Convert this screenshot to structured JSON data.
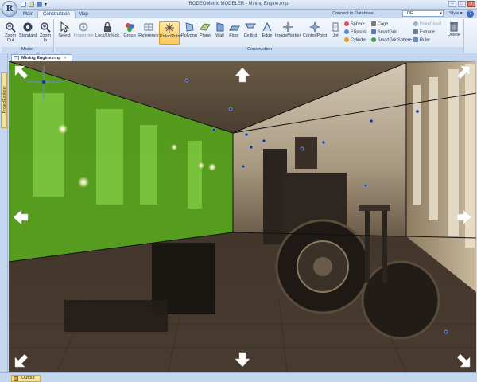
{
  "app": {
    "title": "RODEOMetric MODELER - Mining Engine.rmp",
    "orb_letter": "R"
  },
  "tabs": [
    {
      "label": "Main"
    },
    {
      "label": "Construction"
    },
    {
      "label": "Map"
    }
  ],
  "toolbar_right": {
    "connect_label": "Connect to Database...",
    "ldr_value": "LDR",
    "style_label": "Style",
    "help_glyph": "?"
  },
  "ribbon": {
    "model_group": {
      "label": "Model",
      "buttons": [
        {
          "label": "Zoom\nOut",
          "icon": "zoom-out-icon"
        },
        {
          "label": "Standard",
          "icon": "eye-icon"
        },
        {
          "label": "Zoom\nIn",
          "icon": "zoom-in-icon"
        }
      ]
    },
    "construction_group": {
      "label": "Construction",
      "buttons": [
        {
          "label": "Select",
          "icon": "cursor-icon"
        },
        {
          "label": "Properties",
          "icon": "properties-icon"
        },
        {
          "label": "Lock/Unlock",
          "icon": "lock-icon"
        },
        {
          "label": "Group",
          "icon": "group-icon"
        },
        {
          "label": "Reference",
          "icon": "reference-icon"
        },
        {
          "label": "Polar/Point",
          "icon": "polar-point-icon"
        },
        {
          "label": "Polygon",
          "icon": "polygon-icon"
        },
        {
          "label": "Plane",
          "icon": "plane-icon"
        },
        {
          "label": "Wall",
          "icon": "wall-icon"
        },
        {
          "label": "Floor",
          "icon": "floor-icon"
        },
        {
          "label": "Ceiling",
          "icon": "ceiling-icon"
        },
        {
          "label": "Edge",
          "icon": "edge-icon"
        },
        {
          "label": "ImageMarker",
          "icon": "image-marker-icon"
        },
        {
          "label": "ControlPoint",
          "icon": "control-point-icon"
        },
        {
          "label": "Jot",
          "icon": "jot-icon"
        }
      ],
      "small_buttons": [
        {
          "label": "Sphere",
          "color": "#e05555"
        },
        {
          "label": "Ellipsoid",
          "color": "#5a8ad8"
        },
        {
          "label": "Cylinder",
          "color": "#e89a2a"
        },
        {
          "label": "Cage",
          "color": "#7a7a7a"
        },
        {
          "label": "SmartGrid",
          "color": "#5a7ab8"
        },
        {
          "label": "SmartGridSphere",
          "color": "#4a9a5a"
        },
        {
          "label": "PointCloud",
          "color": "#9ab0cc"
        },
        {
          "label": "Extrude",
          "color": "#6c7c98"
        },
        {
          "label": "Ruler",
          "color": "#6c8cbc"
        }
      ],
      "delete_label": "Delete"
    }
  },
  "side_panel": {
    "tab_label": "ProjectExplorer"
  },
  "document": {
    "tab_label": "Mining Engine.rmp",
    "close_glyph": "×"
  },
  "viewport": {
    "selection_color": "#5ec51a",
    "edge_color": "#111111",
    "control_point_color": "#1c2f8a"
  },
  "output": {
    "tab_label": "Output"
  }
}
